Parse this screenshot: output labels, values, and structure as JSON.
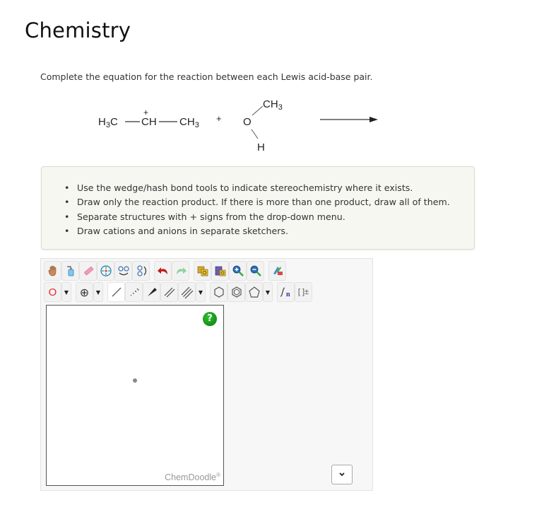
{
  "page": {
    "title": "Chemistry"
  },
  "question": {
    "prompt": "Complete the equation for the reaction between each Lewis acid-base pair.",
    "reaction": {
      "reactant1": {
        "left": "H3C",
        "center": "CH",
        "center_charge": "+",
        "right": "CH3"
      },
      "plus": "+",
      "reactant2": {
        "atom": "O",
        "top_group": "CH3",
        "bottom_group": "H"
      },
      "arrow": "→"
    }
  },
  "instructions": [
    "Use the wedge/hash bond tools to indicate stereochemistry where it exists.",
    "Draw only the reaction product. If there is more than one product, draw all of them.",
    "Separate structures with + signs from the drop-down menu.",
    "Draw cations and anions in separate sketchers."
  ],
  "sketcher": {
    "toolbar_row1": [
      {
        "name": "hand-tool",
        "icon": "hand-icon"
      },
      {
        "name": "clear-tool",
        "icon": "wash-bottle-icon"
      },
      {
        "name": "eraser-tool",
        "icon": "eraser-icon"
      },
      {
        "name": "center-tool",
        "icon": "center-icon"
      },
      {
        "name": "flip-horizontal-tool",
        "icon": "flip-horizontal-icon"
      },
      {
        "name": "flip-vertical-tool",
        "icon": "flip-vertical-icon"
      },
      {
        "name": "undo-tool",
        "icon": "undo-icon"
      },
      {
        "name": "redo-tool",
        "icon": "redo-icon"
      },
      {
        "name": "copy-tool",
        "icon": "copy-icon"
      },
      {
        "name": "paste-tool",
        "icon": "paste-icon"
      },
      {
        "name": "zoom-in-tool",
        "icon": "zoom-in-icon"
      },
      {
        "name": "zoom-out-tool",
        "icon": "zoom-out-icon"
      },
      {
        "name": "clean-tool",
        "icon": "clean-icon"
      }
    ],
    "atom_label": "O",
    "charge_label": "⊕",
    "bracket_label": "[ ]±",
    "repeat_label": "n",
    "branding": "ChemDoodle",
    "branding_mark": "®",
    "help_label": "?",
    "plus_select": {
      "value": "",
      "options_visible": ""
    },
    "colors": {
      "atom_red": "#e8262b",
      "help_green": "#1a9b1a",
      "undo_red": "#c0191a",
      "redo_green": "#7dc98a",
      "repeat_blue": "#2233aa"
    }
  }
}
